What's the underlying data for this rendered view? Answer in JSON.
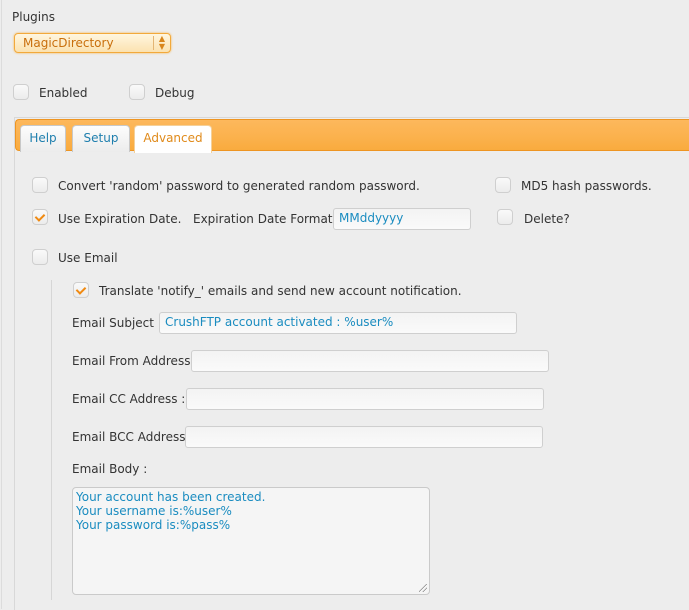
{
  "plugins": {
    "label": "Plugins",
    "selected": "MagicDirectory"
  },
  "top_options": {
    "enabled": {
      "label": "Enabled",
      "checked": false
    },
    "debug": {
      "label": "Debug",
      "checked": false
    }
  },
  "tabs": [
    {
      "label": "Help",
      "active": false
    },
    {
      "label": "Setup",
      "active": false
    },
    {
      "label": "Advanced",
      "active": true
    }
  ],
  "advanced": {
    "convert_random": {
      "label": "Convert 'random' password to generated random password.",
      "checked": false
    },
    "md5_hash": {
      "label": "MD5 hash passwords.",
      "checked": false
    },
    "use_expiration": {
      "label": "Use Expiration Date.",
      "checked": true
    },
    "expiration_format": {
      "label": "Expiration Date Format :",
      "value": "MMddyyyy"
    },
    "delete": {
      "label": "Delete?",
      "checked": false
    },
    "use_email": {
      "label": "Use Email",
      "checked": false
    },
    "translate_notify": {
      "label": "Translate 'notify_' emails and send new account notification.",
      "checked": true
    },
    "email_subject": {
      "label": "Email Subject :",
      "value": "CrushFTP account activated : %user%"
    },
    "email_from": {
      "label": "Email From Address :",
      "value": ""
    },
    "email_cc": {
      "label": "Email CC Address :",
      "value": ""
    },
    "email_bcc": {
      "label": "Email BCC Address :",
      "value": ""
    },
    "email_body": {
      "label": "Email Body :",
      "lines": [
        "Your account has been created.",
        "Your username is:%user%",
        "Your password is:%pass%"
      ]
    }
  }
}
